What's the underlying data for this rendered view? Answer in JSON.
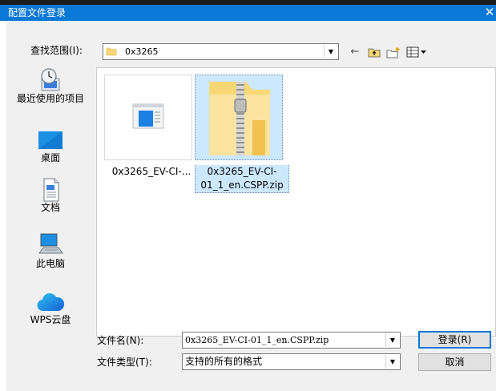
{
  "window": {
    "title": "配置文件登录",
    "close_glyph": "✕"
  },
  "lookin": {
    "label": "查找范围(I):",
    "value": "0x3265"
  },
  "toolbar": {
    "back_glyph": "←",
    "up_glyph": "⤴",
    "newfolder_glyph": "✦",
    "view_glyph": "▦▾"
  },
  "places": [
    {
      "label": "最近使用的项目",
      "icon": "recent-icon"
    },
    {
      "label": "桌面",
      "icon": "desktop-icon"
    },
    {
      "label": "文档",
      "icon": "documents-icon"
    },
    {
      "label": "此电脑",
      "icon": "computer-icon"
    },
    {
      "label": "WPS云盘",
      "icon": "cloud-icon"
    }
  ],
  "files": [
    {
      "name": "0x3265_EV-CI-...",
      "icon": "file-icon",
      "selected": false
    },
    {
      "name": "0x3265_EV-CI-01_1_en.CSPP.zip",
      "icon": "zip-folder-icon",
      "selected": true
    }
  ],
  "filename": {
    "label": "文件名(N):",
    "value": "0x3265_EV-CI-01_1_en.CSPP.zip"
  },
  "filetype": {
    "label": "文件类型(T):",
    "value": "支持的所有的格式"
  },
  "buttons": {
    "ok": "登录(R)",
    "cancel": "取消"
  },
  "colors": {
    "titlebar": "#0a78d7",
    "selection": "#cce8ff",
    "folder": "#f8d775"
  }
}
